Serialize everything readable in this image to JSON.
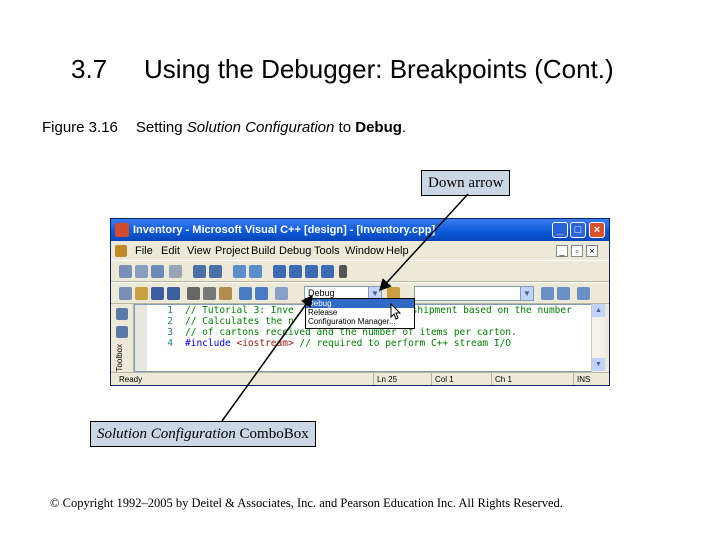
{
  "slide": {
    "number": "3.7",
    "title": "Using the Debugger: Breakpoints (Cont.)",
    "figure_label": "Figure 3.16",
    "caption_parts": [
      "Setting ",
      "Solution Configuration",
      " to ",
      "Debug",
      "."
    ]
  },
  "callouts": {
    "down_arrow": "Down arrow",
    "combo_italic": "Solution Configuration",
    "combo_rest": " ComboBox"
  },
  "window": {
    "title": "Inventory - Microsoft Visual C++ [design] - [Inventory.cpp]",
    "controls": {
      "minimize": "_",
      "maximize": "□",
      "close": "×"
    },
    "menu": [
      "File",
      "Edit",
      "View",
      "Project",
      "Build",
      "Debug",
      "Tools",
      "Window",
      "Help"
    ],
    "config_combo_value": "Debug",
    "config_options": [
      "Debug",
      "Release",
      "Configuration Manager..."
    ],
    "sidebar_label": "Toolbox",
    "code_lines": [
      {
        "num": "1",
        "text": "// Tutorial 3: Inve",
        "tail": "shipment based on the number"
      },
      {
        "num": "2",
        "text": "// Calculates the n",
        "tail": ""
      },
      {
        "num": "3",
        "text": "// of cartons received and the number of items per carton.",
        "tail": ""
      },
      {
        "num": "4",
        "kw": "#include",
        "str": " <iostream>",
        "cm": " // required to perform C++ stream I/O"
      }
    ],
    "status": {
      "ready": "Ready",
      "line": "Ln 25",
      "col": "Col 1",
      "ch": "Ch 1",
      "mode": "INS"
    }
  },
  "copyright": "© Copyright 1992–2005 by Deitel & Associates, Inc. and Pearson Education Inc. All Rights Reserved."
}
